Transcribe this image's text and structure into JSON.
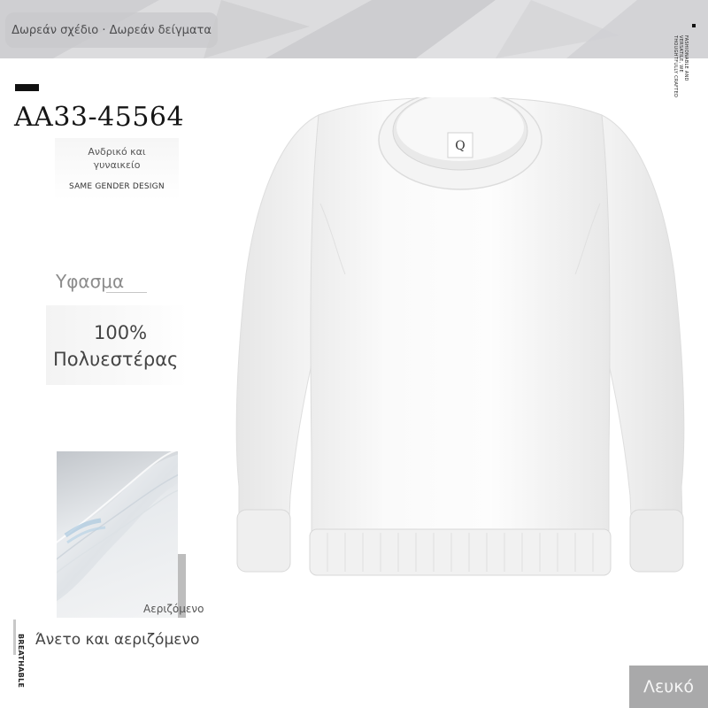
{
  "banner": {
    "text": "Δωρεάν σχέδιο · Δωρεάν δείγματα",
    "side_text": "FASHIONABLE AND\nVERSATILE, WE\nTHOUGHTFULLY CRAFTED"
  },
  "product": {
    "code": "AA33-45564",
    "gender": "Ανδρικό και γυναικείο",
    "gender_en": "SAME GENDER DESIGN",
    "neck_label_letter": "Q"
  },
  "fabric": {
    "label": "Υφασμα",
    "percent": "100%",
    "material": "Πολυεστέρας"
  },
  "feature": {
    "swatch_caption": "Αεριζόμενο",
    "vertical_label": "BREATHABLE",
    "text": "Άνετο και αεριζόμενο"
  },
  "color_badge": "Λευκό",
  "colors": {
    "banner_bg": "#d7d7d9",
    "badge_bg": "#a9a9aa",
    "sweatshirt": "#fbfbfb"
  }
}
